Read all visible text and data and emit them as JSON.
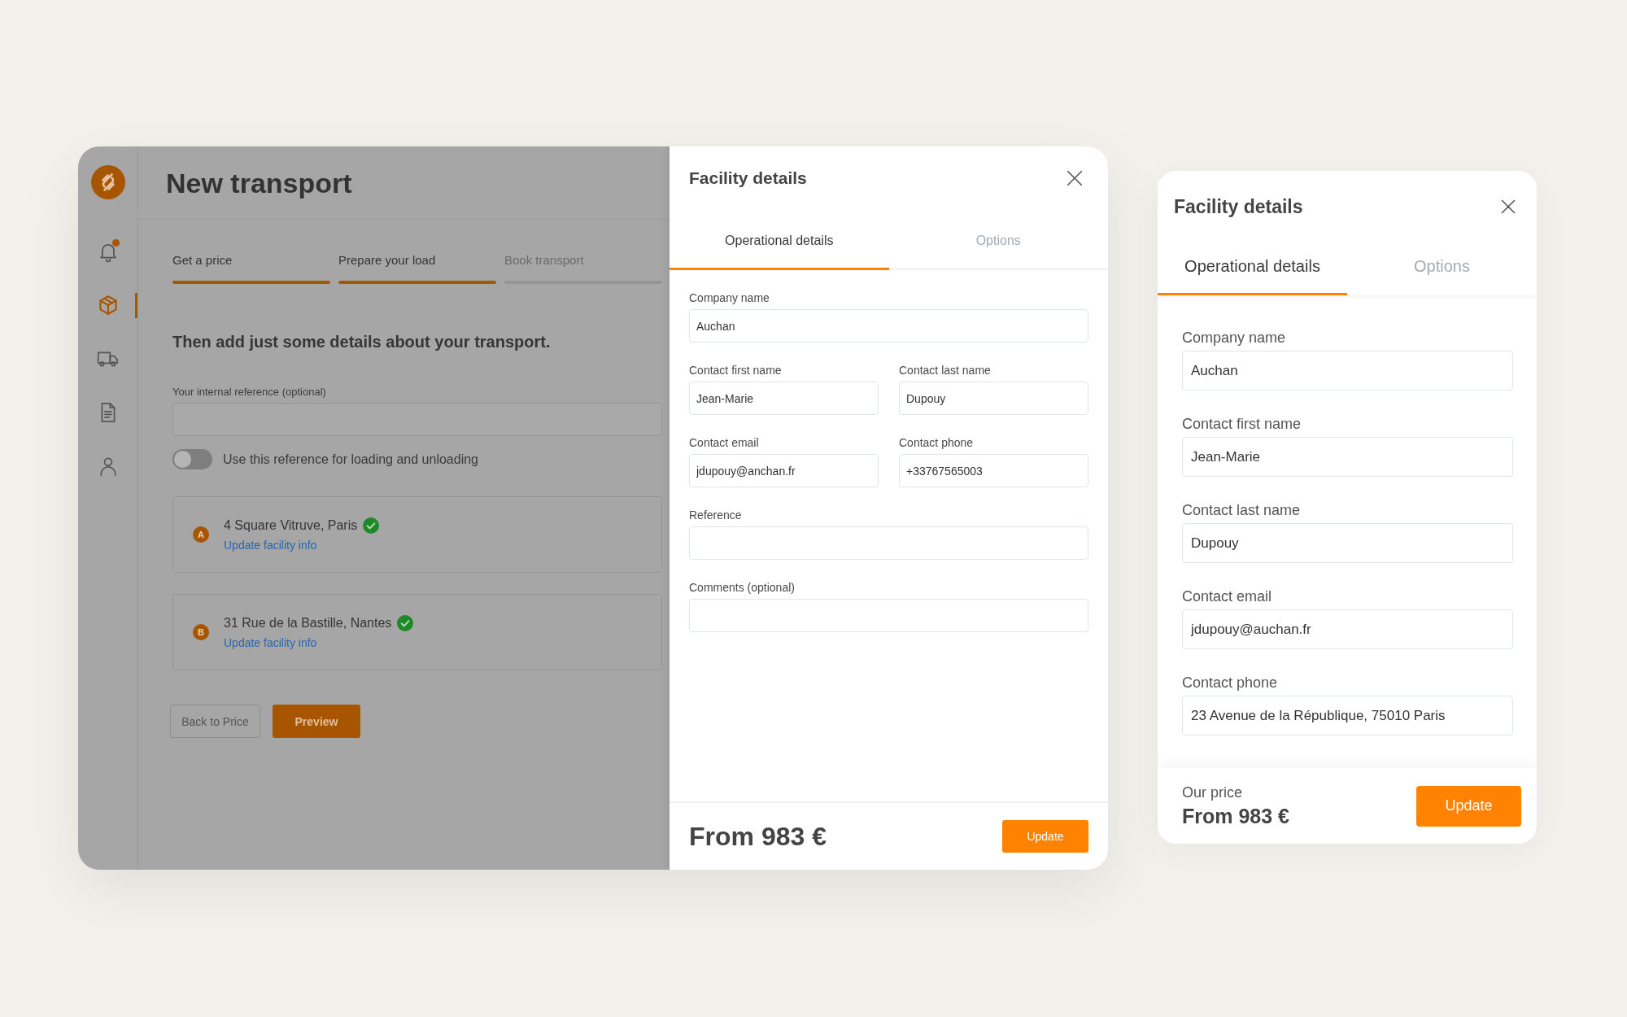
{
  "app": {
    "sidebar": {
      "items": [
        {
          "selected": false,
          "unread": true
        },
        {
          "selected": true,
          "unread": false
        },
        {
          "selected": false,
          "unread": false
        },
        {
          "selected": false,
          "unread": false
        },
        {
          "selected": false,
          "unread": false
        }
      ]
    },
    "title": "New transport",
    "steps": [
      {
        "label": "Get a price",
        "completed": true
      },
      {
        "label": "Prepare your load",
        "completed": true
      },
      {
        "label": "Book transport",
        "completed": false
      }
    ],
    "heading": "Then add just some details about your transport.",
    "reference_field": {
      "label": "Your internal reference (optional)"
    },
    "toggle": {
      "label": "Use this reference for loading and unloading",
      "on": false
    },
    "stops": [
      {
        "marker": "A",
        "address": "4 Square Vitruve, Paris",
        "verified": true,
        "link": "Update facility info"
      },
      {
        "marker": "B",
        "address": "31 Rue de la Bastille, Nantes",
        "verified": true,
        "link": "Update facility info"
      }
    ],
    "buttons": [
      {
        "label": "Back to Price",
        "kind": "secondary"
      },
      {
        "label": "Preview",
        "kind": "primary"
      }
    ]
  },
  "drawer": {
    "title": "Facility details",
    "tabs": [
      {
        "label": "Operational details",
        "selected": true
      },
      {
        "label": "Options",
        "selected": false
      }
    ],
    "rows": [
      [
        {
          "label": "Company name",
          "value": "Auchan"
        }
      ],
      [
        {
          "label": "Contact first name",
          "value": "Jean-Marie"
        },
        {
          "label": "Contact last name",
          "value": "Dupouy"
        }
      ],
      [
        {
          "label": "Contact email",
          "value": "jdupouy@anchan.fr"
        },
        {
          "label": "Contact phone",
          "value": "+33767565003"
        }
      ],
      [
        {
          "label": "Reference"
        }
      ],
      [
        {
          "label": "Comments (optional)"
        }
      ]
    ],
    "price": "From 983 €",
    "button": "Update"
  },
  "mobile_panel": {
    "title": "Facility details",
    "tabs": [
      {
        "label": "Operational details",
        "selected": true
      },
      {
        "label": "Options",
        "selected": false
      }
    ],
    "fields": [
      {
        "label": "Company name",
        "value": "Auchan"
      },
      {
        "label": "Contact first name",
        "value": "Jean-Marie"
      },
      {
        "label": "Contact last name",
        "value": "Dupouy"
      },
      {
        "label": "Contact email",
        "value": "jdupouy@auchan.fr"
      },
      {
        "label": "Contact phone",
        "value": "23 Avenue de la République, 75010 Paris"
      }
    ],
    "price_label": "Our price",
    "price": "From 983 €",
    "button": "Update"
  }
}
